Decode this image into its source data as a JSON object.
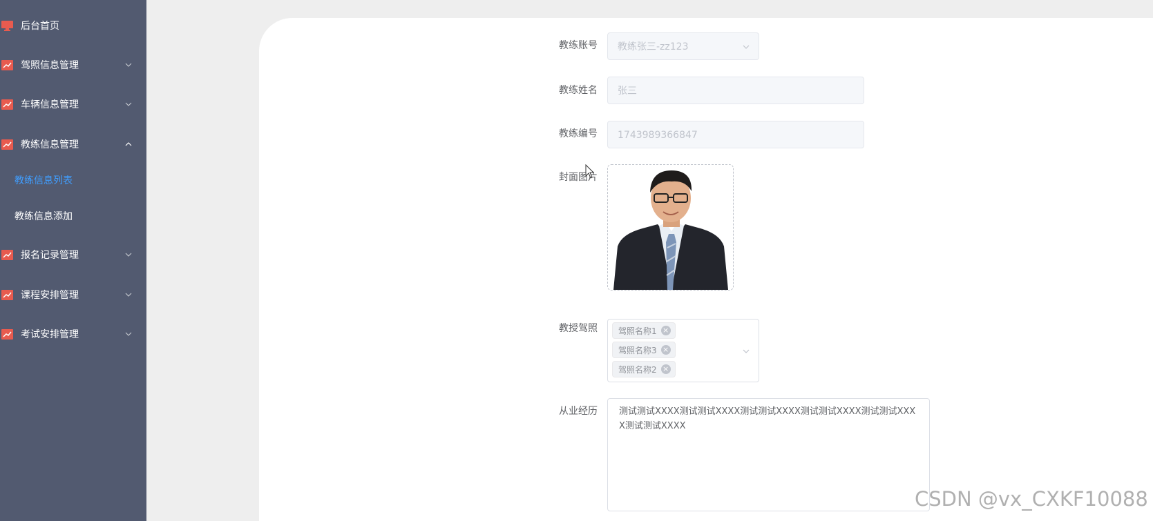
{
  "sidebar": {
    "items": [
      {
        "label": "后台首页",
        "icon": "monitor-icon",
        "expanded": null
      },
      {
        "label": "驾照信息管理",
        "icon": "chart-icon",
        "expanded": false
      },
      {
        "label": "车辆信息管理",
        "icon": "chart-icon",
        "expanded": false
      },
      {
        "label": "教练信息管理",
        "icon": "chart-icon",
        "expanded": true
      },
      {
        "label": "报名记录管理",
        "icon": "chart-icon",
        "expanded": false
      },
      {
        "label": "课程安排管理",
        "icon": "chart-icon",
        "expanded": false
      },
      {
        "label": "考试安排管理",
        "icon": "chart-icon",
        "expanded": false
      }
    ],
    "subitems": [
      {
        "label": "教练信息列表",
        "active": true
      },
      {
        "label": "教练信息添加",
        "active": false
      }
    ]
  },
  "form": {
    "coach_account": {
      "label": "教练账号",
      "value": "教练张三-zz123"
    },
    "coach_name": {
      "label": "教练姓名",
      "value": "张三"
    },
    "coach_number": {
      "label": "教练编号",
      "value": "1743989366847"
    },
    "cover": {
      "label": "封面图片"
    },
    "licenses": {
      "label": "教授驾照",
      "tags": [
        "驾照名称1",
        "驾照名称3",
        "驾照名称2"
      ]
    },
    "experience": {
      "label": "从业经历",
      "value": "测试测试XXXX测试测试XXXX测试测试XXXX测试测试XXXX测试测试XXXX测试测试XXXX"
    }
  },
  "watermark": "CSDN @vx_CXKF10088",
  "colors": {
    "sidebar_bg": "#525a70",
    "active_link": "#409eff",
    "menu_icon": "#e85b4f"
  }
}
